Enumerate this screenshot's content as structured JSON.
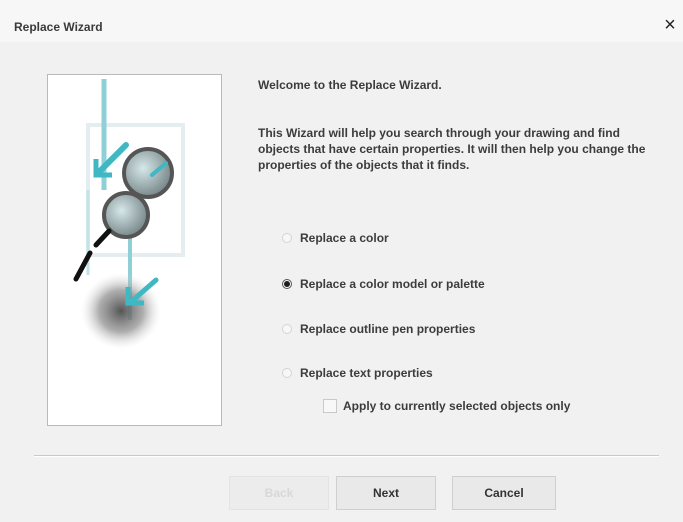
{
  "window": {
    "title": "Replace Wizard",
    "close_symbol": "×"
  },
  "intro": {
    "welcome": "Welcome to the Replace Wizard.",
    "description": "This Wizard will help you search through your drawing and find objects that have certain properties. It will then help you change the properties of the objects that it finds."
  },
  "options": [
    {
      "label": "Replace a color",
      "selected": false
    },
    {
      "label": "Replace a color model or palette",
      "selected": true
    },
    {
      "label": "Replace outline pen properties",
      "selected": false
    },
    {
      "label": "Replace text properties",
      "selected": false
    }
  ],
  "apply_checkbox": {
    "label": "Apply to currently selected objects only",
    "checked": false
  },
  "buttons": {
    "back": "Back",
    "next": "Next",
    "cancel": "Cancel"
  },
  "colors": {
    "accent": "#3fb8c4",
    "window_bg": "#f1f1f1"
  }
}
